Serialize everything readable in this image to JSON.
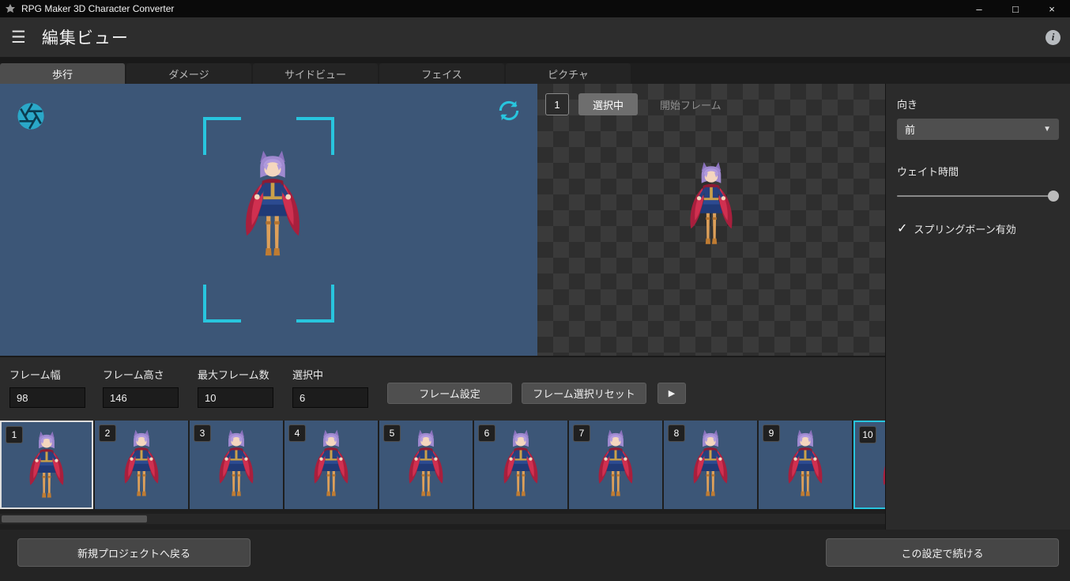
{
  "window": {
    "title": "RPG Maker 3D Character Converter",
    "minimize": "–",
    "maximize": "□",
    "close": "×"
  },
  "header": {
    "menu_icon": "☰",
    "title": "編集ビュー",
    "info_glyph": "i"
  },
  "tabs": [
    {
      "label": "歩行"
    },
    {
      "label": "ダメージ"
    },
    {
      "label": "サイドビュー"
    },
    {
      "label": "フェイス"
    },
    {
      "label": "ピクチャ"
    }
  ],
  "animation_panel": {
    "frame_badge": "1",
    "selected_button": "選択中",
    "start_frame_label": "開始フレーム"
  },
  "direction_panel": {
    "direction_label": "向き",
    "direction_value": "前",
    "chevron": "▼",
    "wait_label": "ウェイト時間",
    "springbone_checkmark": "✓",
    "springbone_label": "スプリングボーン有効"
  },
  "frame_settings": {
    "width_label": "フレーム幅",
    "width_value": "98",
    "height_label": "フレーム高さ",
    "height_value": "146",
    "max_label": "最大フレーム数",
    "max_value": "10",
    "selected_label": "選択中",
    "selected_value": "6",
    "set_button": "フレーム設定",
    "reset_button": "フレーム選択リセット",
    "play_glyph": "▶"
  },
  "frames": [
    {
      "number": "1"
    },
    {
      "number": "2"
    },
    {
      "number": "3"
    },
    {
      "number": "4"
    },
    {
      "number": "5"
    },
    {
      "number": "6"
    },
    {
      "number": "7"
    },
    {
      "number": "8"
    },
    {
      "number": "9"
    },
    {
      "number": "10"
    }
  ],
  "footer": {
    "back_button": "新規プロジェクトへ戻る",
    "continue_button": "この設定で続ける"
  },
  "colors": {
    "accent_cyan": "#28c5de",
    "preview_blue": "#3c5677",
    "cape_red": "#b02440",
    "hair_purple": "#a08ad0"
  }
}
